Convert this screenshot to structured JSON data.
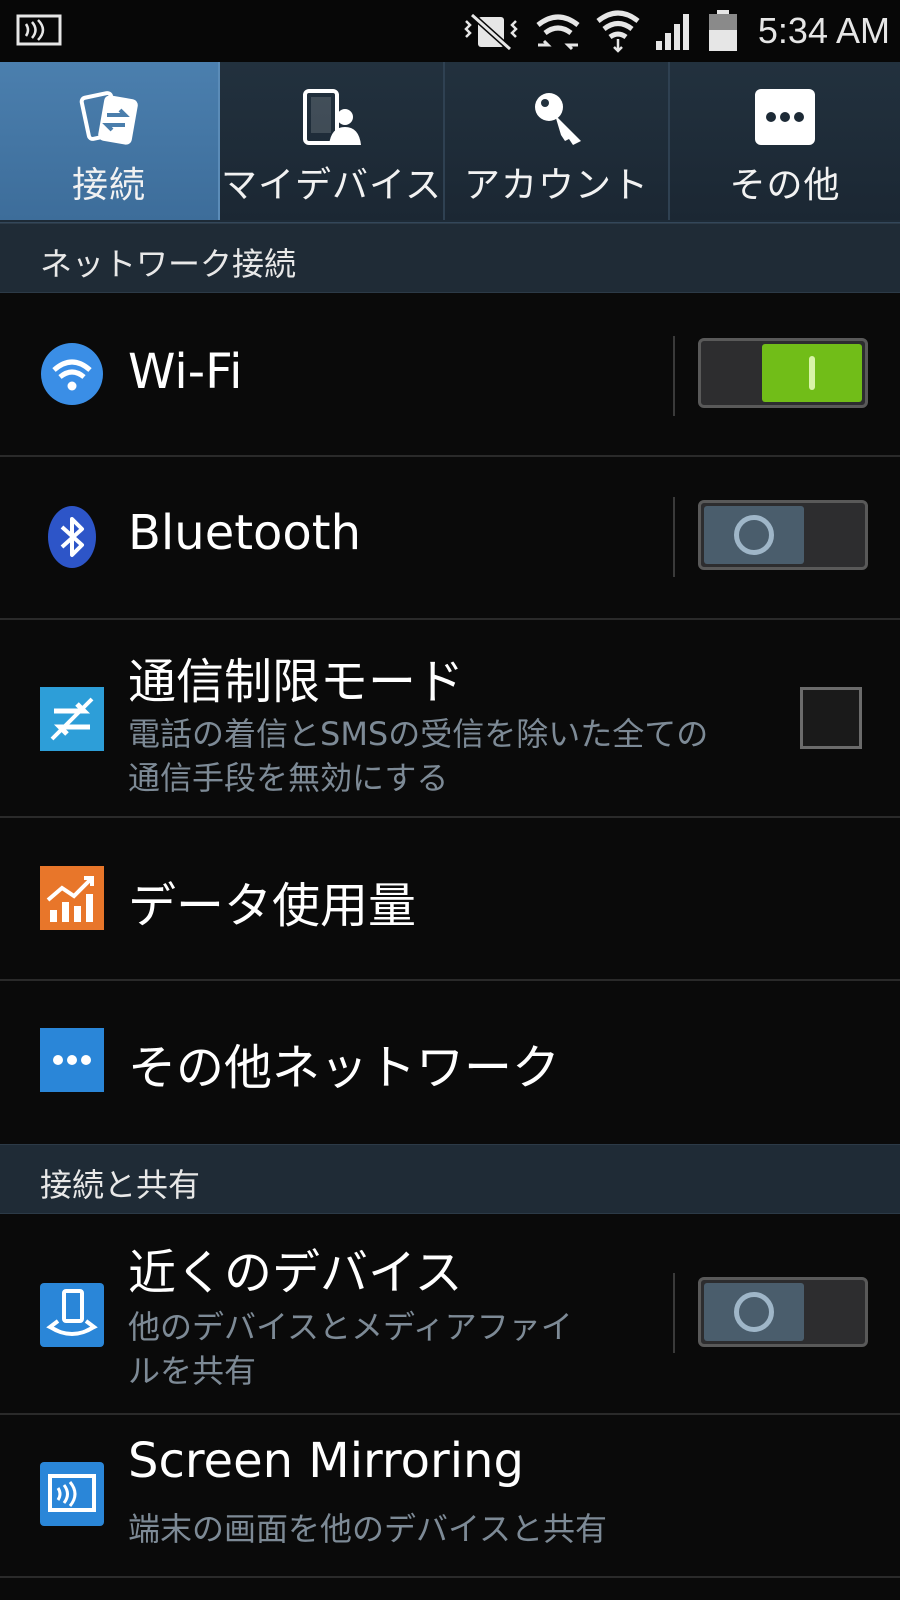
{
  "status_bar": {
    "time": "5:34 AM",
    "icons": [
      "screen-mirroring-icon",
      "mute-vibrate-icon",
      "wifi-direct-icon",
      "wifi-icon",
      "signal-icon",
      "battery-icon"
    ]
  },
  "tabs": [
    {
      "label": "接続",
      "icon": "connections-icon",
      "active": true
    },
    {
      "label": "マイデバイス",
      "icon": "my-device-icon",
      "active": false
    },
    {
      "label": "アカウント",
      "icon": "accounts-icon",
      "active": false
    },
    {
      "label": "その他",
      "icon": "more-icon",
      "active": false
    }
  ],
  "sections": {
    "network": "ネットワーク接続",
    "share": "接続と共有"
  },
  "rows": {
    "wifi": {
      "title": "Wi-Fi",
      "toggle": "on"
    },
    "bluetooth": {
      "title": "Bluetooth",
      "toggle": "off"
    },
    "airplane": {
      "title": "通信制限モード",
      "sub1": "電話の着信とSMSの受信を除いた全ての",
      "sub2": "通信手段を無効にする",
      "checked": false
    },
    "data_usage": {
      "title": "データ使用量"
    },
    "more_networks": {
      "title": "その他ネットワーク"
    },
    "nearby": {
      "title": "近くのデバイス",
      "sub1": "他のデバイスとメディアファイ",
      "sub2": "ルを共有",
      "toggle": "off"
    },
    "mirroring": {
      "title": "Screen Mirroring",
      "sub": "端末の画面を他のデバイスと共有"
    }
  },
  "colors": {
    "accent_tab": "#4a7eac",
    "toggle_on": "#71bd18",
    "section_bg": "#1f2b36",
    "wifi_icon": "#3a8ee6",
    "bluetooth_icon": "#2d55c8",
    "airplane_icon": "#2d9ed8",
    "data_icon": "#e8762a",
    "more_icon": "#2a86d8"
  }
}
